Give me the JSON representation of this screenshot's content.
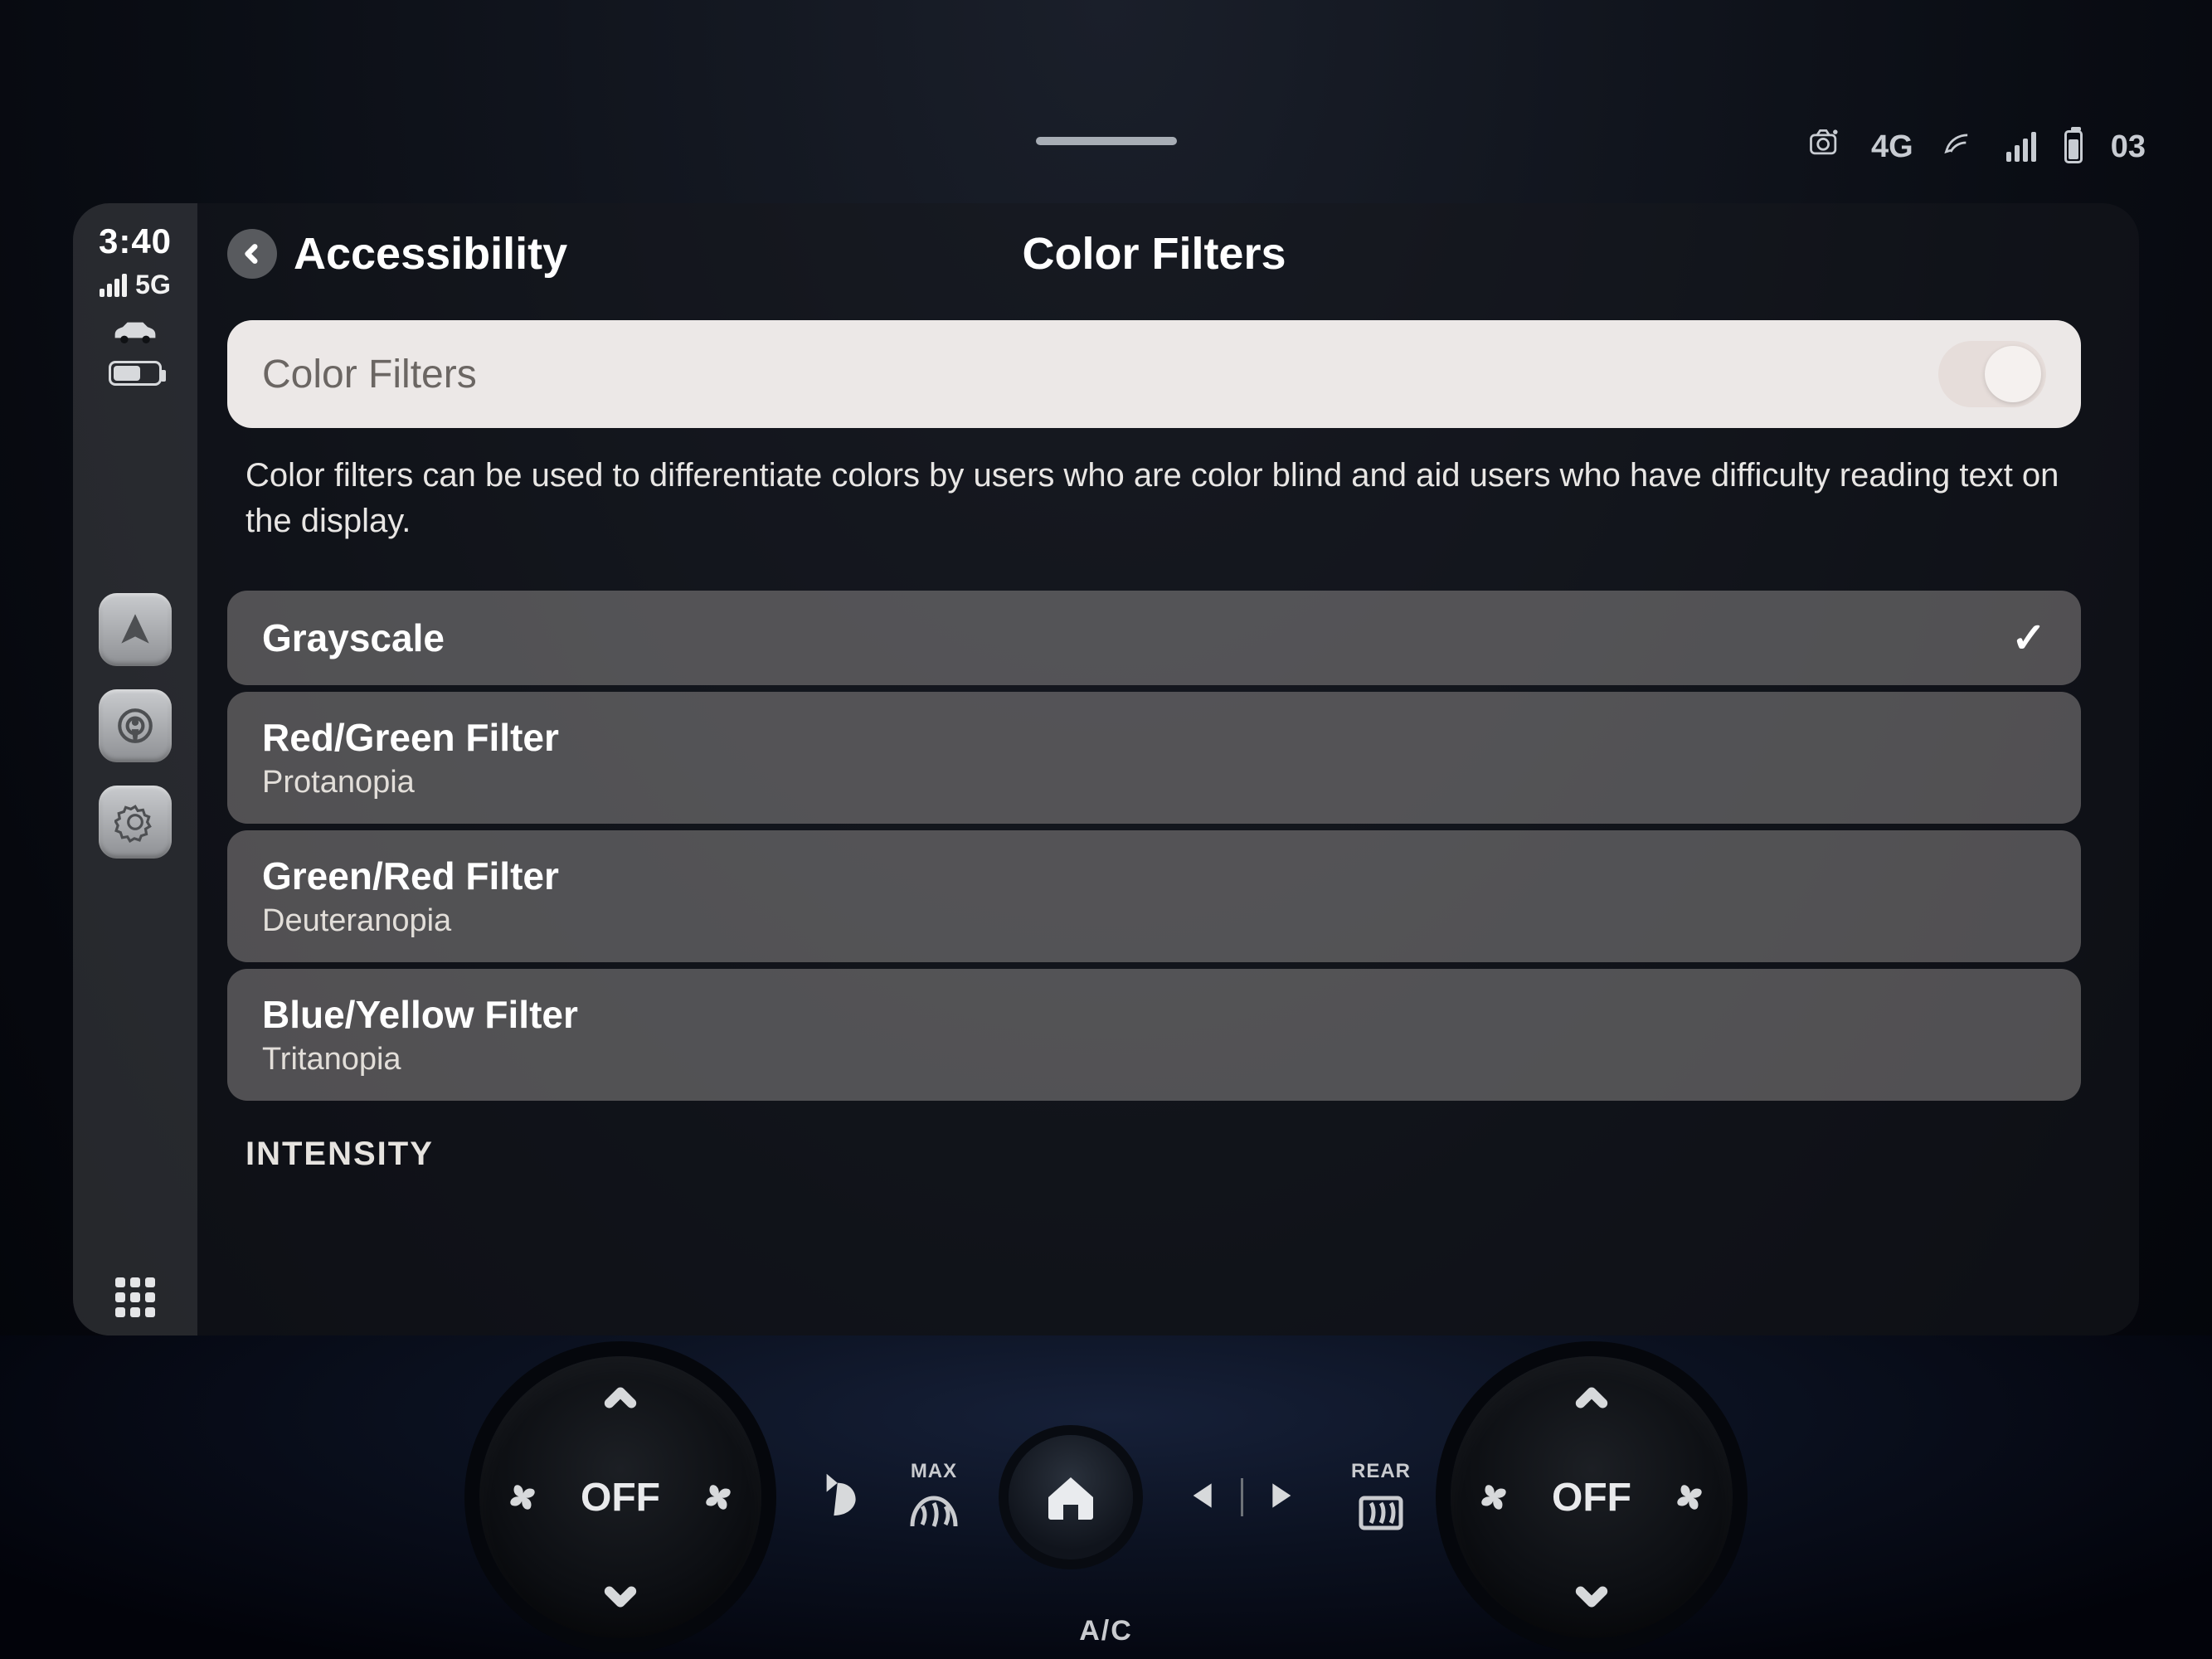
{
  "vehicle_status": {
    "network_label": "4G",
    "time_fragment": "03"
  },
  "sidebar": {
    "time": "3:40",
    "network": "5G",
    "apps": [
      "maps",
      "podcasts",
      "settings"
    ]
  },
  "header": {
    "back_label": "Accessibility",
    "title": "Color Filters"
  },
  "toggle": {
    "label": "Color Filters",
    "on": true
  },
  "description": "Color filters can be used to differentiate colors by users who are color blind and aid users who have difficulty reading text on the display.",
  "options": [
    {
      "title": "Grayscale",
      "subtitle": "",
      "selected": true
    },
    {
      "title": "Red/Green Filter",
      "subtitle": "Protanopia",
      "selected": false
    },
    {
      "title": "Green/Red Filter",
      "subtitle": "Deuteranopia",
      "selected": false
    },
    {
      "title": "Blue/Yellow Filter",
      "subtitle": "Tritanopia",
      "selected": false
    }
  ],
  "section_label": "INTENSITY",
  "climate": {
    "left_dial": "OFF",
    "right_dial": "OFF",
    "max_label": "MAX",
    "ac_label": "A/C",
    "rear_label": "REAR"
  }
}
